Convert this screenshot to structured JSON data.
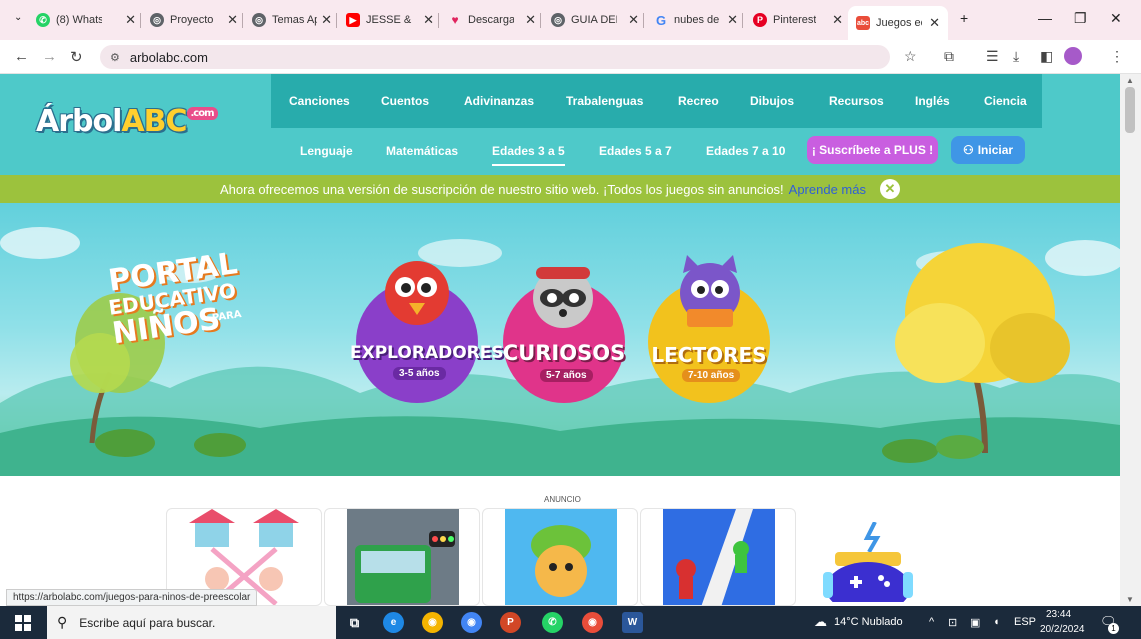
{
  "browser": {
    "tabs": [
      {
        "label": "(8) Whats",
        "icon": "whatsapp-icon",
        "color": "#25d366"
      },
      {
        "label": "Proyecto",
        "icon": "globe-icon",
        "color": "#5f6368"
      },
      {
        "label": "Temas Ap",
        "icon": "globe-icon",
        "color": "#5f6368"
      },
      {
        "label": "JESSE & J",
        "icon": "youtube-icon",
        "color": "#ff0000"
      },
      {
        "label": "Descarga",
        "icon": "heart-icon",
        "color": "#e0245e"
      },
      {
        "label": "GUIA DEL",
        "icon": "globe-icon",
        "color": "#5f6368"
      },
      {
        "label": "nubes de",
        "icon": "google-icon",
        "color": "#4285f4"
      },
      {
        "label": "Pinterest",
        "icon": "pinterest-icon",
        "color": "#e60023"
      },
      {
        "label": "Juegos ec",
        "icon": "arbolabc-icon",
        "color": "#e94d3a"
      }
    ],
    "url": "arbolabc.com",
    "status_url": "https://arbolabc.com/juegos-para-ninos-de-preescolar"
  },
  "site": {
    "logo_main": "Árbol",
    "logo_abc": "ABC",
    "logo_com": ".com",
    "nav_primary": [
      "Canciones",
      "Cuentos",
      "Adivinanzas",
      "Trabalenguas",
      "Recreo",
      "Dibujos",
      "Recursos",
      "Inglés",
      "Ciencia"
    ],
    "nav_secondary": [
      "Lenguaje",
      "Matemáticas",
      "Edades 3 a 5",
      "Edades 5 a 7",
      "Edades 7 a 10"
    ],
    "subscribe_label": "¡ Suscríbete a PLUS !",
    "login_label": "Iniciar",
    "banner_text": "Ahora ofrecemos una versión de suscripción de nuestro sitio web. ¡Todos los juegos sin anuncios!",
    "banner_link": "Aprende más",
    "hero": {
      "portal_line1": "PORTAL",
      "portal_line2": "EDUCATIVO",
      "portal_line3": "NIÑOS",
      "portal_para": "PARA",
      "groups": [
        {
          "name": "EXPLORADORES",
          "age": "3-5 años",
          "color": "#8a3fc9"
        },
        {
          "name": "CURIOSOS",
          "age": "5-7 años",
          "color": "#e0348a"
        },
        {
          "name": "LECTORES",
          "age": "7-10 años",
          "color": "#f2c21d"
        }
      ]
    },
    "ad_label": "ANUNCIO"
  },
  "taskbar": {
    "search_placeholder": "Escribe aquí para buscar.",
    "weather": "14°C Nublado",
    "lang": "ESP",
    "time": "23:44",
    "date": "20/2/2024",
    "notification_count": "1"
  }
}
